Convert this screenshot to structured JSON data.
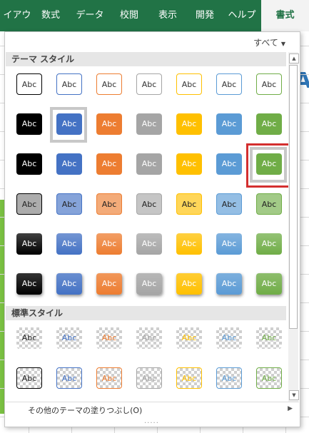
{
  "ribbon": {
    "tabs": [
      "イアウト",
      "数式",
      "データ",
      "校閲",
      "表示",
      "開発",
      "ヘルプ",
      "書式"
    ],
    "active_tab": "書式",
    "accent": "#217346"
  },
  "panel": {
    "filter_label": "すべて",
    "theme_section": "テーマ スタイル",
    "standard_section": "標準スタイル",
    "swatch_text": "Abc",
    "more_fills": "その他のテーマの塗りつぶし(O)",
    "grip": "....."
  },
  "theme_colors": [
    "#000000",
    "#4472c4",
    "#ed7d31",
    "#a5a5a5",
    "#ffc000",
    "#5b9bd5",
    "#70ad47"
  ],
  "selected_swatch": {
    "row": 2,
    "col": 6
  },
  "hover_swatch": {
    "row": 1,
    "col": 1
  }
}
